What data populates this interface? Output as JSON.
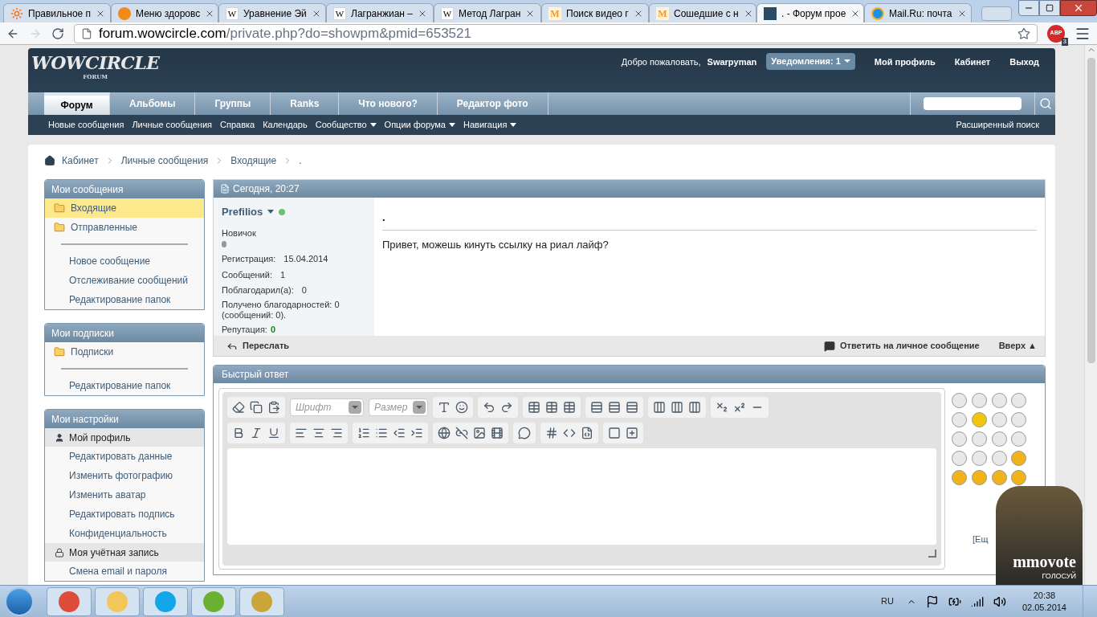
{
  "browser": {
    "tabs": [
      {
        "title": "Правильное п",
        "kind": "sun",
        "selected": false
      },
      {
        "title": "Меню здоровс",
        "kind": "orange",
        "selected": false
      },
      {
        "title": "Уравнение Эй",
        "kind": "letter",
        "glyph": "W",
        "selected": false
      },
      {
        "title": "Лагранжиан –",
        "kind": "letter",
        "glyph": "W",
        "selected": false
      },
      {
        "title": "Метод Лагран",
        "kind": "letter",
        "glyph": "W",
        "selected": false
      },
      {
        "title": "Поиск видео г",
        "kind": "mletter",
        "glyph": "M",
        "selected": false
      },
      {
        "title": "Сошедшие с н",
        "kind": "mletter",
        "glyph": "M",
        "selected": false
      },
      {
        "title": ". - Форум прое",
        "kind": "forum",
        "selected": true
      },
      {
        "title": "Mail.Ru: почта",
        "kind": "at",
        "selected": false
      }
    ],
    "url_host": "forum.wowcircle.com",
    "url_path": "/private.php?do=showpm&pmid=653521",
    "abp_label": "ABP",
    "abp_count": "3"
  },
  "header": {
    "logo": "WOWCIRCLE",
    "logo_sub": "FORUM",
    "welcome": "Добро пожаловать,",
    "user": "Swarpyman",
    "notifications": "Уведомления: 1",
    "links": [
      "Мой профиль",
      "Кабинет",
      "Выход"
    ],
    "nav_tabs": [
      {
        "label": "Форум",
        "selected": true
      },
      {
        "label": "Альбомы",
        "selected": false
      },
      {
        "label": "Группы",
        "selected": false
      },
      {
        "label": "Ranks",
        "selected": false
      },
      {
        "label": "Что нового?",
        "selected": false
      },
      {
        "label": "Редактор фото",
        "selected": false
      }
    ],
    "subnav": [
      {
        "label": "Новые сообщения",
        "dropdown": false
      },
      {
        "label": "Личные сообщения",
        "dropdown": false
      },
      {
        "label": "Справка",
        "dropdown": false
      },
      {
        "label": "Календарь",
        "dropdown": false
      },
      {
        "label": "Сообщество",
        "dropdown": true
      },
      {
        "label": "Опции форума",
        "dropdown": true
      },
      {
        "label": "Навигация",
        "dropdown": true
      }
    ],
    "advanced_search": "Расширенный поиск"
  },
  "breadcrumb": [
    "Кабинет",
    "Личные сообщения",
    "Входящие",
    "."
  ],
  "sidebar": [
    {
      "title": "Мои сообщения",
      "items": [
        {
          "kind": "folder",
          "label": "Входящие",
          "selected": true
        },
        {
          "kind": "folder",
          "label": "Отправленные",
          "selected": false
        },
        {
          "kind": "divider"
        },
        {
          "kind": "link",
          "label": "Новое сообщение",
          "selected": false
        },
        {
          "kind": "link",
          "label": "Отслеживание сообщений",
          "selected": false
        },
        {
          "kind": "link",
          "label": "Редактирование папок",
          "selected": false
        }
      ]
    },
    {
      "title": "Мои подписки",
      "items": [
        {
          "kind": "folder",
          "label": "Подписки",
          "selected": false
        },
        {
          "kind": "divider"
        },
        {
          "kind": "link",
          "label": "Редактирование папок",
          "selected": false
        }
      ]
    },
    {
      "title": "Мои настройки",
      "items": [
        {
          "kind": "profile_section",
          "label": "Мой профиль"
        },
        {
          "kind": "link",
          "label": "Редактировать данные",
          "selected": false
        },
        {
          "kind": "link",
          "label": "Изменить фотографию",
          "selected": false
        },
        {
          "kind": "link",
          "label": "Изменить аватар",
          "selected": false
        },
        {
          "kind": "link",
          "label": "Редактировать подпись",
          "selected": false
        },
        {
          "kind": "link",
          "label": "Конфиденциальность",
          "selected": false
        },
        {
          "kind": "account_section",
          "label": "Моя учётная запись"
        },
        {
          "kind": "link",
          "label": "Смена email и пароля",
          "selected": false
        }
      ]
    }
  ],
  "message": {
    "date": "Сегодня, 20:27",
    "author": "Prefilios",
    "online": true,
    "rank": "Новичок",
    "stats": [
      {
        "label": "Регистрация:",
        "value": "15.04.2014"
      },
      {
        "label": "Сообщений:",
        "value": "1"
      },
      {
        "label": "Поблагодарил(а):",
        "value": "0"
      }
    ],
    "thanks": "Получено благодарностей: 0 (сообщений: 0).",
    "reputation_label": "Репутация:",
    "reputation": "0",
    "title": ".",
    "body": "Привет, можешь кинуть ссылку на риал лайф?",
    "forward": "Переслать",
    "reply": "Ответить на личное сообщение",
    "top": "Вверх ▲"
  },
  "quick_reply": {
    "title": "Быстрый ответ",
    "font_placeholder": "Шрифт",
    "size_placeholder": "Размер",
    "more": "[Ещ"
  },
  "vote_banner": {
    "brand": "mmovote",
    "call": "ГОЛОСУЙ"
  },
  "taskbar": {
    "lang": "RU",
    "time": "20:38",
    "date": "02.05.2014"
  }
}
